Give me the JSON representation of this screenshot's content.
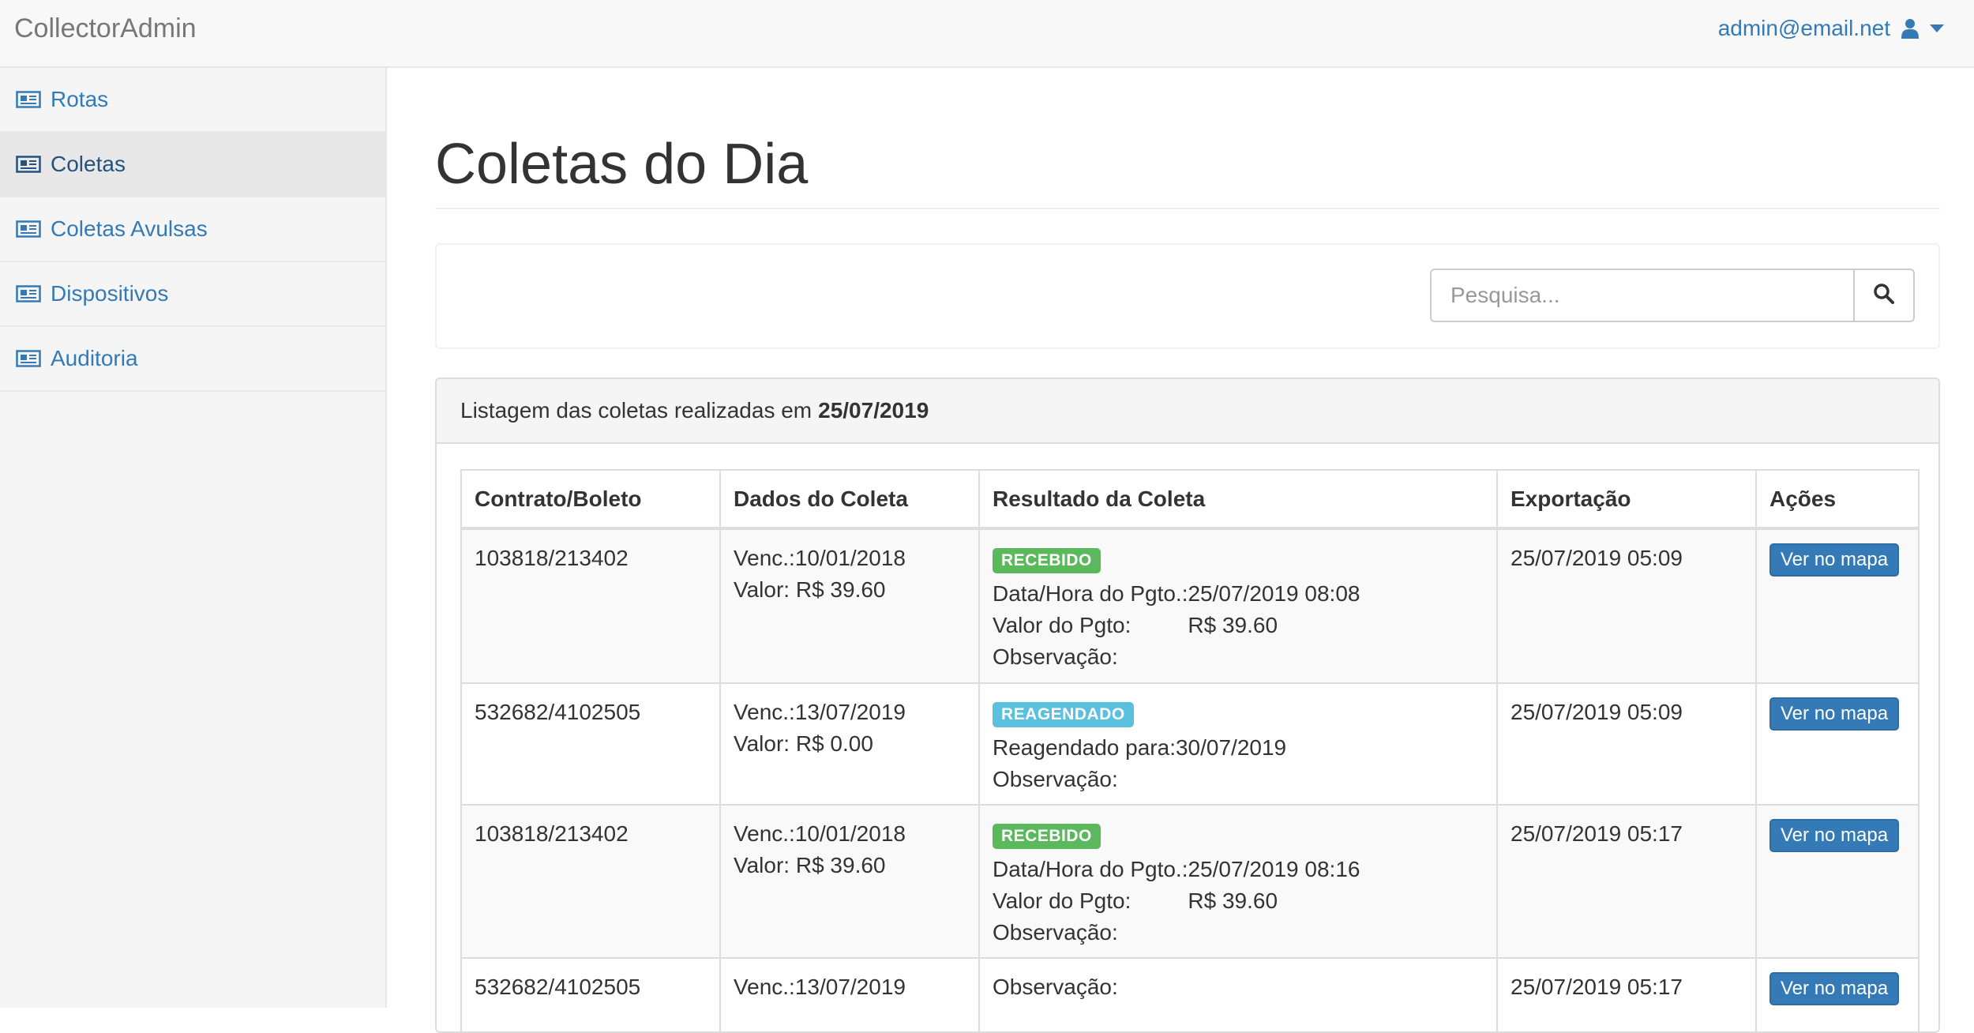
{
  "app": {
    "brand": "CollectorAdmin",
    "user_email": "admin@email.net"
  },
  "sidebar": {
    "items": [
      {
        "label": "Rotas",
        "icon": "newspaper-icon",
        "active": false
      },
      {
        "label": "Coletas",
        "icon": "newspaper-icon",
        "active": true
      },
      {
        "label": "Coletas Avulsas",
        "icon": "newspaper-icon",
        "active": false
      },
      {
        "label": "Dispositivos",
        "icon": "newspaper-icon",
        "active": false
      },
      {
        "label": "Auditoria",
        "icon": "newspaper-icon",
        "active": false
      }
    ]
  },
  "main": {
    "title": "Coletas do Dia",
    "search": {
      "placeholder": "Pesquisa...",
      "value": "",
      "icon": "search-icon"
    },
    "panel": {
      "heading_prefix": "Listagem das coletas realizadas em",
      "heading_date": "25/07/2019"
    },
    "table": {
      "columns": [
        "Contrato/Boleto",
        "Dados do Coleta",
        "Resultado da Coleta",
        "Exportação",
        "Ações"
      ],
      "rows": [
        {
          "contract": "103818/213402",
          "venc": "Venc.:10/01/2018",
          "valor": "Valor: R$ 39.60",
          "badge": "RECEBIDO",
          "payment_datetime": "Data/Hora do Pgto.:25/07/2019 08:08",
          "payment_value_label": "Valor do Pgto:",
          "payment_value": "R$ 39.60",
          "observacao": "Observação:",
          "export": "25/07/2019 05:09",
          "action": "Ver no mapa"
        },
        {
          "contract": "532682/4102505",
          "venc": "Venc.:13/07/2019",
          "valor": "Valor: R$ 0.00",
          "badge": "REAGENDADO",
          "reagendado": "Reagendado para:30/07/2019",
          "observacao": "Observação:",
          "export": "25/07/2019 05:09",
          "action": "Ver no mapa"
        },
        {
          "contract": "103818/213402",
          "venc": "Venc.:10/01/2018",
          "valor": "Valor: R$ 39.60",
          "badge": "RECEBIDO",
          "payment_datetime": "Data/Hora do Pgto.:25/07/2019 08:16",
          "payment_value_label": "Valor do Pgto:",
          "payment_value": "R$ 39.60",
          "observacao": "Observação:",
          "export": "25/07/2019 05:17",
          "action": "Ver no mapa"
        },
        {
          "contract": "532682/4102505",
          "venc": "Venc.:13/07/2019",
          "observacao": "Observação:",
          "export": "25/07/2019 05:17",
          "action": "Ver no mapa"
        }
      ]
    }
  },
  "colors": {
    "link": "#337ab7",
    "badge_success": "#5cb85c",
    "badge_info": "#5bc0de",
    "button_primary": "#337ab7"
  }
}
